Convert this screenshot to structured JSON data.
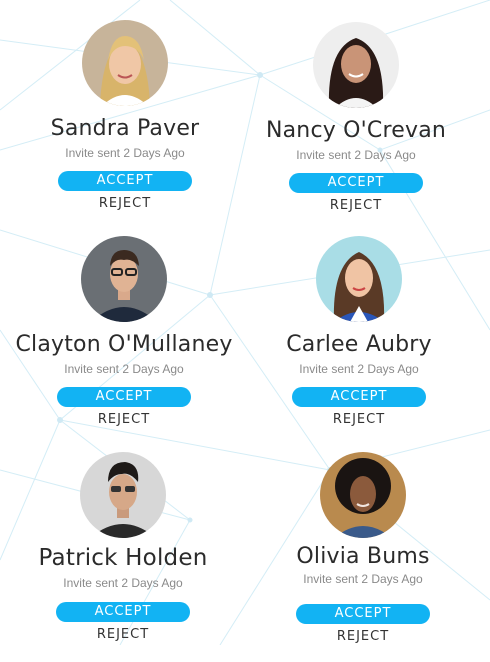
{
  "invites": [
    {
      "name": "Sandra Paver",
      "status": "Invite sent 2 Days Ago",
      "accept_label": "ACCEPT",
      "reject_label": "REJECT",
      "avatar": "woman-blonde-avatar"
    },
    {
      "name": "Nancy O'Crevan",
      "status": "Invite sent 2 Days Ago",
      "accept_label": "ACCEPT",
      "reject_label": "REJECT",
      "avatar": "woman-dark-hair-avatar"
    },
    {
      "name": "Clayton O'Mullaney",
      "status": "Invite sent 2 Days Ago",
      "accept_label": "ACCEPT",
      "reject_label": "REJECT",
      "avatar": "man-glasses-avatar"
    },
    {
      "name": "Carlee Aubry",
      "status": "Invite sent 2 Days Ago",
      "accept_label": "ACCEPT",
      "reject_label": "REJECT",
      "avatar": "woman-brunette-avatar"
    },
    {
      "name": "Patrick Holden",
      "status": "Invite sent 2 Days Ago",
      "accept_label": "ACCEPT",
      "reject_label": "REJECT",
      "avatar": "man-sunglasses-avatar"
    },
    {
      "name": "Olivia Bums",
      "status": "Invite sent 2 Days Ago",
      "accept_label": "ACCEPT",
      "reject_label": "REJECT",
      "avatar": "woman-curly-hair-avatar"
    }
  ],
  "colors": {
    "accent": "#12b3f3",
    "name_text": "#2b2b2b",
    "status_text": "#8a8a8a",
    "network_lines": "#d8eef6"
  }
}
